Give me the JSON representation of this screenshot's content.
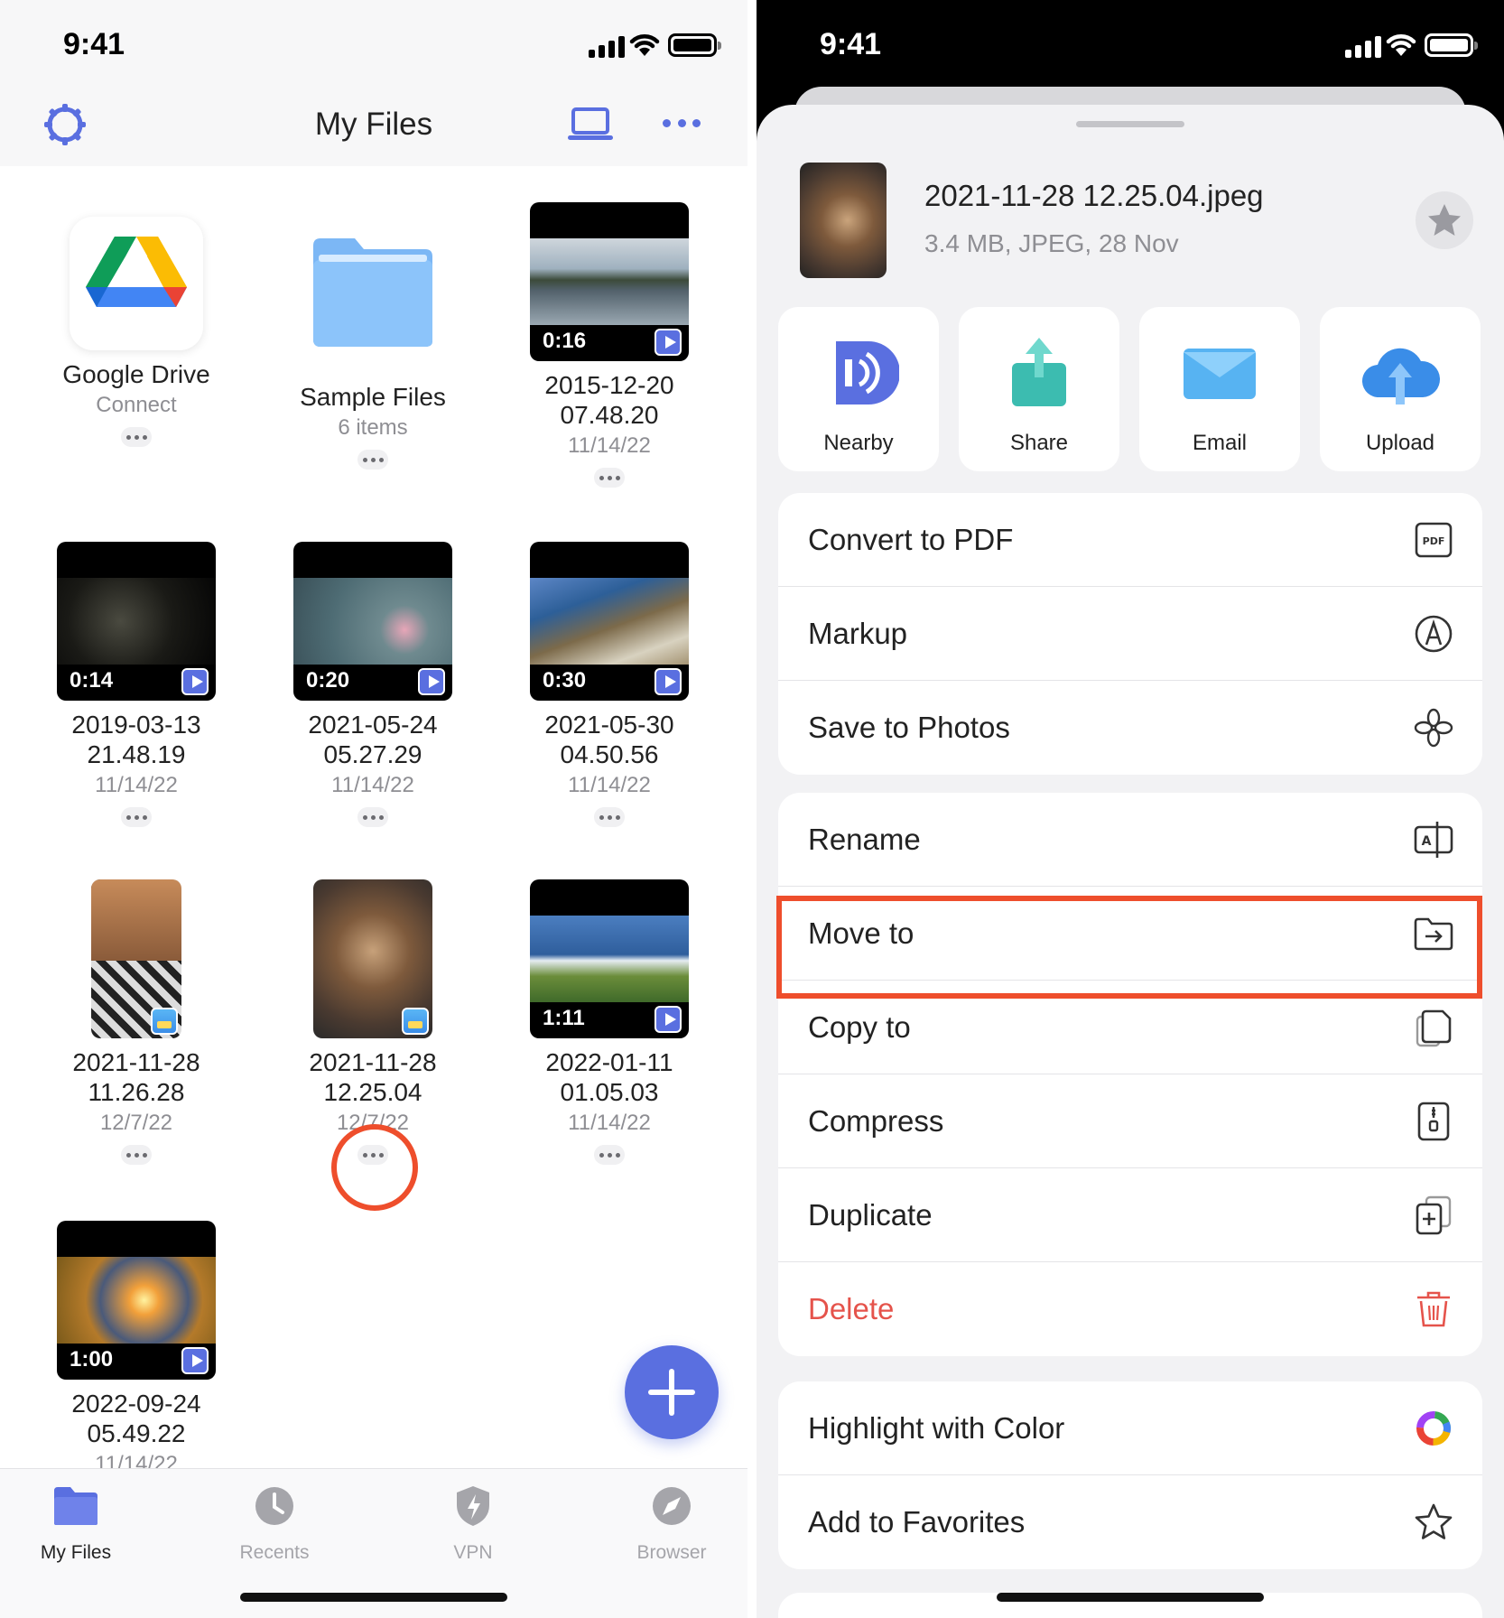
{
  "left": {
    "status_time": "9:41",
    "header": {
      "title": "My Files"
    },
    "items": [
      {
        "name": "Google Drive",
        "sub": "Connect",
        "kind": "gdrive"
      },
      {
        "name": "Sample Files",
        "sub": "6 items",
        "kind": "folder"
      },
      {
        "name": "2015-12-20\n07.48.20",
        "sub": "11/14/22",
        "duration": "0:16",
        "kind": "video"
      },
      {
        "name": "2019-03-13\n21.48.19",
        "sub": "11/14/22",
        "duration": "0:14",
        "kind": "video"
      },
      {
        "name": "2021-05-24\n05.27.29",
        "sub": "11/14/22",
        "duration": "0:20",
        "kind": "video"
      },
      {
        "name": "2021-05-30\n04.50.56",
        "sub": "11/14/22",
        "duration": "0:30",
        "kind": "video"
      },
      {
        "name": "2021-11-28\n11.26.28",
        "sub": "12/7/22",
        "kind": "photo"
      },
      {
        "name": "2021-11-28\n12.25.04",
        "sub": "12/7/22",
        "kind": "photo"
      },
      {
        "name": "2022-01-11\n01.05.03",
        "sub": "11/14/22",
        "duration": "1:11",
        "kind": "video"
      },
      {
        "name": "2022-09-24\n05.49.22",
        "sub": "11/14/22",
        "duration": "1:00",
        "kind": "video"
      }
    ],
    "tabs": [
      {
        "label": "My Files",
        "icon": "folder-icon",
        "active": true
      },
      {
        "label": "Recents",
        "icon": "clock-icon",
        "active": false
      },
      {
        "label": "VPN",
        "icon": "shield-icon",
        "active": false
      },
      {
        "label": "Browser",
        "icon": "compass-icon",
        "active": false
      }
    ],
    "accent": "#5a6fe0"
  },
  "right": {
    "status_time": "9:41",
    "file": {
      "name": "2021-11-28 12.25.04.jpeg",
      "meta": "3.4 MB, JPEG, 28 Nov"
    },
    "quick_actions": [
      {
        "label": "Nearby",
        "icon": "nearby-icon"
      },
      {
        "label": "Share",
        "icon": "share-icon"
      },
      {
        "label": "Email",
        "icon": "email-icon"
      },
      {
        "label": "Upload",
        "icon": "upload-icon"
      }
    ],
    "group1": [
      {
        "label": "Convert to PDF",
        "icon": "pdf-convert-icon"
      },
      {
        "label": "Markup",
        "icon": "markup-icon"
      },
      {
        "label": "Save to Photos",
        "icon": "photos-icon"
      }
    ],
    "group2": [
      {
        "label": "Rename",
        "icon": "rename-icon"
      },
      {
        "label": "Move to",
        "icon": "move-folder-icon"
      },
      {
        "label": "Copy to",
        "icon": "copy-icon"
      },
      {
        "label": "Compress",
        "icon": "zip-icon"
      },
      {
        "label": "Duplicate",
        "icon": "duplicate-icon"
      },
      {
        "label": "Delete",
        "icon": "trash-icon"
      }
    ],
    "group3": [
      {
        "label": "Highlight with Color",
        "icon": "color-wheel-icon"
      },
      {
        "label": "Add to Favorites",
        "icon": "star-outline-icon"
      }
    ],
    "danger_color": "#e5534b",
    "annotation_color": "#ee4e2c"
  }
}
